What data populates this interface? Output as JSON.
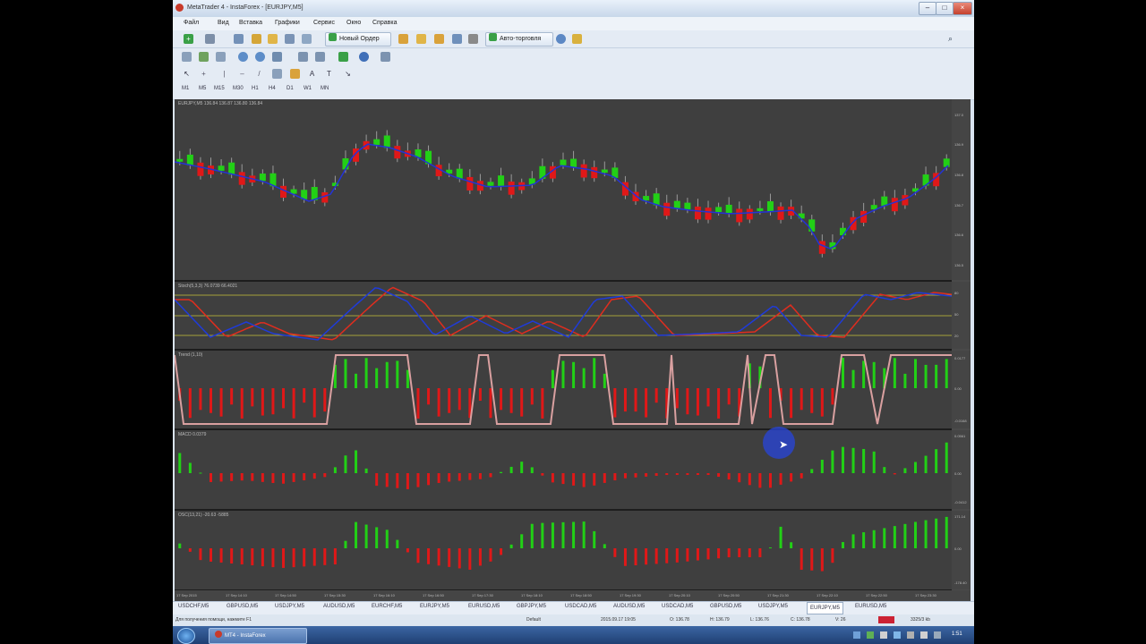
{
  "window": {
    "title": "MetaTrader 4 - InstaForex - [EURJPY,M5]",
    "controls": [
      "–",
      "□",
      "×"
    ]
  },
  "menu": [
    "Файл",
    "Вид",
    "Вставка",
    "Графики",
    "Сервис",
    "Окно",
    "Справка"
  ],
  "toolbar": {
    "new_order": "Новый Ордер",
    "auto_trading": "Авто-торговля",
    "timeframes": [
      "M1",
      "M5",
      "M15",
      "M30",
      "H1",
      "H4",
      "D1",
      "W1",
      "MN"
    ]
  },
  "panels": {
    "price": {
      "label": "EURJPY,M5  136.84 136.87 136.80 136.84",
      "scale": [
        "137.0",
        "136.9",
        "136.8",
        "136.7",
        "136.6",
        "136.5"
      ]
    },
    "stoch": {
      "label": "Stoch(5,3,3) 76.0739 66.4021",
      "scale": [
        "80",
        "50",
        "20"
      ]
    },
    "trend": {
      "label": "Trend (1,10)",
      "scale": [
        "0.0177",
        "0.00",
        "-0.0168"
      ]
    },
    "macd": {
      "label": "MACD 0.0379",
      "scale": [
        "0.0561",
        "0.00",
        "-0.0412"
      ]
    },
    "osc": {
      "label": "OSC(13,21) -20.63 -5885",
      "scale": [
        "171.14",
        "0.00",
        "-178.40"
      ]
    }
  },
  "time_axis": [
    "17 Sep 2015",
    "17 Sep 14:10",
    "17 Sep 14:50",
    "17 Sep 15:30",
    "17 Sep 16:10",
    "17 Sep 16:50",
    "17 Sep 17:30",
    "17 Sep 18:10",
    "17 Sep 18:50",
    "17 Sep 19:30",
    "17 Sep 20:10",
    "17 Sep 20:50",
    "17 Sep 21:30",
    "17 Sep 22:10",
    "17 Sep 22:50",
    "17 Sep 23:30"
  ],
  "symbol_tabs": [
    "USDCHF,M5",
    "GBPUSD,M5",
    "USDJPY,M5",
    "AUDUSD,M5",
    "EURCHF,M5",
    "EURJPY,M5",
    "EURUSD,M5",
    "GBPJPY,M5",
    "USDCAD,M5",
    "AUDUSD,M5",
    "USDCAD,M5",
    "GBPUSD,M5",
    "USDJPY,M5",
    "EURJPY,M5",
    "EURUSD,M5"
  ],
  "active_tab": "EURJPY,M5",
  "status": {
    "help": "Для получения помощи, нажмите F1",
    "profile": "Default",
    "datetime": "2015.09.17 19:05",
    "open": "O: 136.78",
    "high": "H: 136.79",
    "low": "L: 136.76",
    "close": "C: 136.78",
    "volume": "V: 26",
    "traffic": "3325/3 kb"
  },
  "taskbar": {
    "app": "MT4 - InstaForex",
    "clock": "1:51"
  },
  "colors": {
    "bull": "#22d016",
    "bear": "#e01818",
    "ma": "#2433d6",
    "stoch_main": "#1f3bd9",
    "stoch_signal": "#e02d1e",
    "level": "#a6a23a",
    "trend_line": "#d9a0a0"
  }
}
